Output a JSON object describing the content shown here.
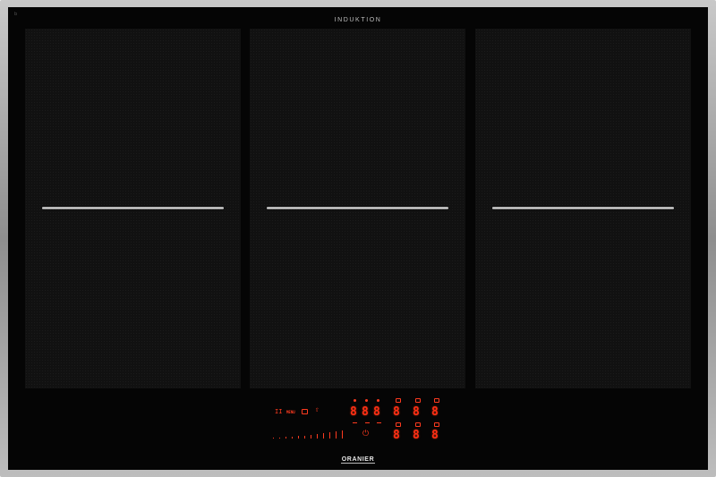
{
  "hob": {
    "top_label": "INDUKTION",
    "corner_mark": "b",
    "brand_logo": "ORANIER",
    "zones": [
      {
        "name": "left-cooking-zone"
      },
      {
        "name": "center-cooking-zone"
      },
      {
        "name": "right-cooking-zone"
      }
    ],
    "controls": {
      "pause_icon": "II",
      "menu_label": "MENU",
      "keeps_warm_icon": "warm-icon",
      "lock_icon": "lock-icon",
      "power_icon": "power-icon",
      "displays_row1": [
        "8",
        "8",
        "8",
        "8",
        "8",
        "8"
      ],
      "displays_row2": [
        "8",
        "8",
        "8"
      ],
      "slider_steps": 12
    },
    "colors": {
      "display_red": "#ff3b1f",
      "glass": "#050505",
      "frame": "#a8a8a8"
    }
  }
}
